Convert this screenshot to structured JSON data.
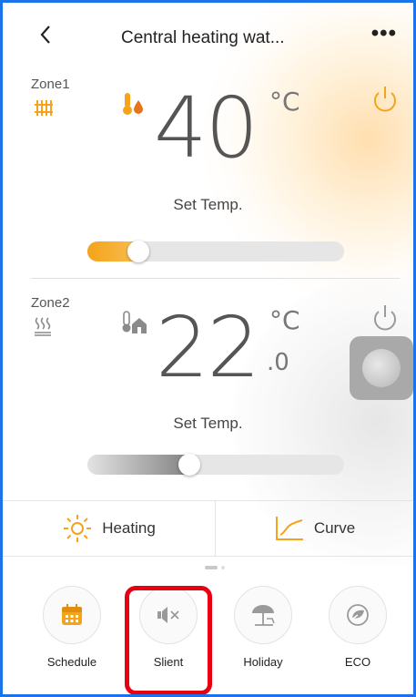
{
  "header": {
    "back_icon": "chevron-left-icon",
    "back_glyph": "<",
    "title": "Central heating wat...",
    "more_glyph": "•••"
  },
  "zone1": {
    "label": "Zone1",
    "zone_icon": "radiator-icon",
    "mode_icon": "thermometer-droplet-icon",
    "temperature": "40",
    "unit": "°C",
    "set_label": "Set Temp.",
    "power_on": true,
    "slider_level": 0.2,
    "accent": "#f5a31a"
  },
  "zone2": {
    "label": "Zone2",
    "zone_icon": "floor-heating-icon",
    "mode_icon": "thermometer-house-icon",
    "temperature": "22",
    "decimal": ".0",
    "unit": "°C",
    "set_label": "Set Temp.",
    "power_on": false,
    "slider_level": 0.4,
    "accent": "#9a9a9a"
  },
  "modes": {
    "heating_label": "Heating",
    "heating_icon": "sun-icon",
    "curve_label": "Curve",
    "curve_icon": "curve-chart-icon"
  },
  "functions": [
    {
      "label": "Schedule",
      "icon": "calendar-icon"
    },
    {
      "label": "Slient",
      "icon": "speaker-mute-icon"
    },
    {
      "label": "Holiday",
      "icon": "beach-umbrella-icon"
    },
    {
      "label": "ECO",
      "icon": "eco-leaf-icon"
    }
  ],
  "colors": {
    "accent": "#f5a31a",
    "highlight": "#e60012",
    "frame": "#1a73e8"
  }
}
